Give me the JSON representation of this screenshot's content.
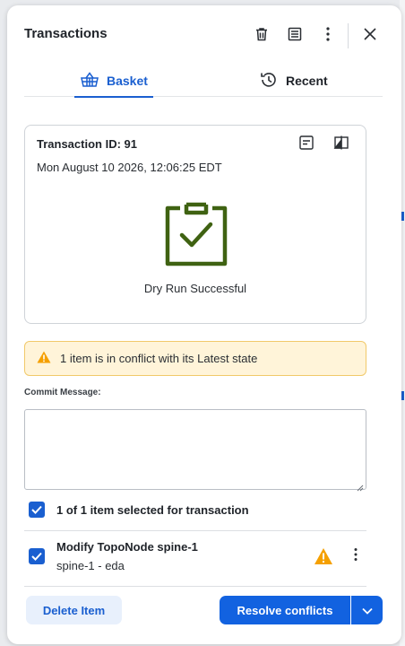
{
  "panel": {
    "title": "Transactions"
  },
  "header": {
    "icons": [
      "trash-icon",
      "list-icon",
      "kebab-icon",
      "close-icon"
    ]
  },
  "tabs": [
    {
      "label": "Basket",
      "icon": "basket-icon",
      "active": true
    },
    {
      "label": "Recent",
      "icon": "history-icon",
      "active": false
    }
  ],
  "transaction": {
    "id_label": "Transaction ID: 91",
    "datetime": "Mon August 10 2026, 12:06:25 EDT",
    "status_text": "Dry Run Successful",
    "status_icon": "clipboard-check-icon",
    "status_color": "#3f6212"
  },
  "warning": {
    "text": "1 item is in conflict with its Latest state",
    "icon": "warning-icon"
  },
  "commit": {
    "label": "Commit Message:",
    "value": "",
    "placeholder": ""
  },
  "selection": {
    "summary": "1 of 1 item selected for transaction",
    "checked": true
  },
  "items": [
    {
      "title": "Modify TopoNode spine-1",
      "subtitle": "spine-1 - eda",
      "checked": true,
      "conflict": true
    }
  ],
  "footer": {
    "delete_label": "Delete Item",
    "resolve_label": "Resolve conflicts"
  },
  "colors": {
    "accent": "#1262e0",
    "warning_bg": "#fff4d9",
    "warning_border": "#f1c96a",
    "warning_icon": "#f5a000"
  }
}
